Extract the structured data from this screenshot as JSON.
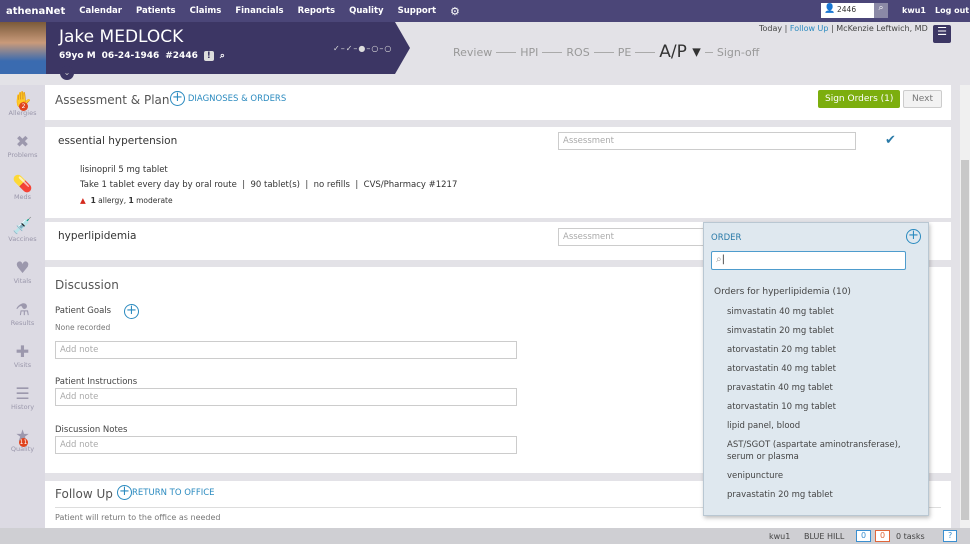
{
  "topbar": {
    "logo": "athenaNet",
    "nav": [
      "Calendar",
      "Patients",
      "Claims",
      "Financials",
      "Reports",
      "Quality",
      "Support"
    ],
    "patient_search": "2446",
    "user": "kwu1",
    "logout": "Log out"
  },
  "patient": {
    "name": "Jake MEDLOCK",
    "age_sex": "69yo M",
    "dob": "06-24-1946",
    "id": "#2446",
    "alert": "!",
    "progress": "✓–✓–●–○–○"
  },
  "workflow": {
    "steps": [
      "Review",
      "HPI",
      "ROS",
      "PE",
      "A/P ▾",
      "Sign-off"
    ],
    "active": 4
  },
  "context": {
    "today": "Today",
    "follow_up": "Follow Up",
    "provider": "McKenzie Leftwich, MD"
  },
  "sidebar": [
    {
      "label": "Allergies",
      "icon": "✋",
      "badge": "2"
    },
    {
      "label": "Problems",
      "icon": "✖"
    },
    {
      "label": "Meds",
      "icon": "💊"
    },
    {
      "label": "Vaccines",
      "icon": "💉"
    },
    {
      "label": "Vitals",
      "icon": "♥"
    },
    {
      "label": "Results",
      "icon": "⚗"
    },
    {
      "label": "Visits",
      "icon": "✚"
    },
    {
      "label": "History",
      "icon": "☰"
    },
    {
      "label": "Quality",
      "icon": "★",
      "badge": "11"
    }
  ],
  "ap": {
    "title": "Assessment & Plan",
    "add_link": "DIAGNOSES & ORDERS",
    "sign_orders": "Sign Orders (1)",
    "next": "Next"
  },
  "diagnoses": [
    {
      "name": "essential hypertension",
      "assessment_placeholder": "Assessment",
      "med": "lisinopril 5 mg tablet",
      "sig": "Take 1 tablet every day by oral route",
      "qty": "90 tablet(s)",
      "refills": "no refills",
      "pharmacy": "CVS/Pharmacy #1217",
      "allergy_count": "1",
      "allergy_text": "allergy,",
      "moderate_count": "1",
      "moderate_text": "moderate"
    },
    {
      "name": "hyperlipidemia",
      "assessment_placeholder": "Assessment"
    }
  ],
  "discussion": {
    "title": "Discussion",
    "goals_label": "Patient Goals",
    "goals_value": "None recorded",
    "note_placeholder": "Add note",
    "instructions_label": "Patient Instructions",
    "notes_label": "Discussion Notes"
  },
  "followup": {
    "title": "Follow Up",
    "add_link": "RETURN TO OFFICE",
    "text": "Patient will return to the office as needed"
  },
  "order_popup": {
    "title": "ORDER",
    "search_value": "",
    "group": "Orders for hyperlipidemia (10)",
    "items": [
      "simvastatin 40 mg tablet",
      "simvastatin 20 mg tablet",
      "atorvastatin 20 mg tablet",
      "atorvastatin 40 mg tablet",
      "pravastatin 40 mg tablet",
      "atorvastatin 10 mg tablet",
      "lipid panel, blood",
      "AST/SGOT (aspartate aminotransferase), serum or plasma",
      "venipuncture",
      "pravastatin 20 mg tablet"
    ]
  },
  "statusbar": {
    "user": "kwu1",
    "location": "BLUE HILL",
    "count_blue": "0",
    "count_orange": "0",
    "tasks": "0 tasks",
    "help": "?"
  },
  "colors": {
    "topbar": "#4b4678",
    "header": "#3c3664",
    "accent": "#2a8abf",
    "sign": "#7cae0e"
  }
}
